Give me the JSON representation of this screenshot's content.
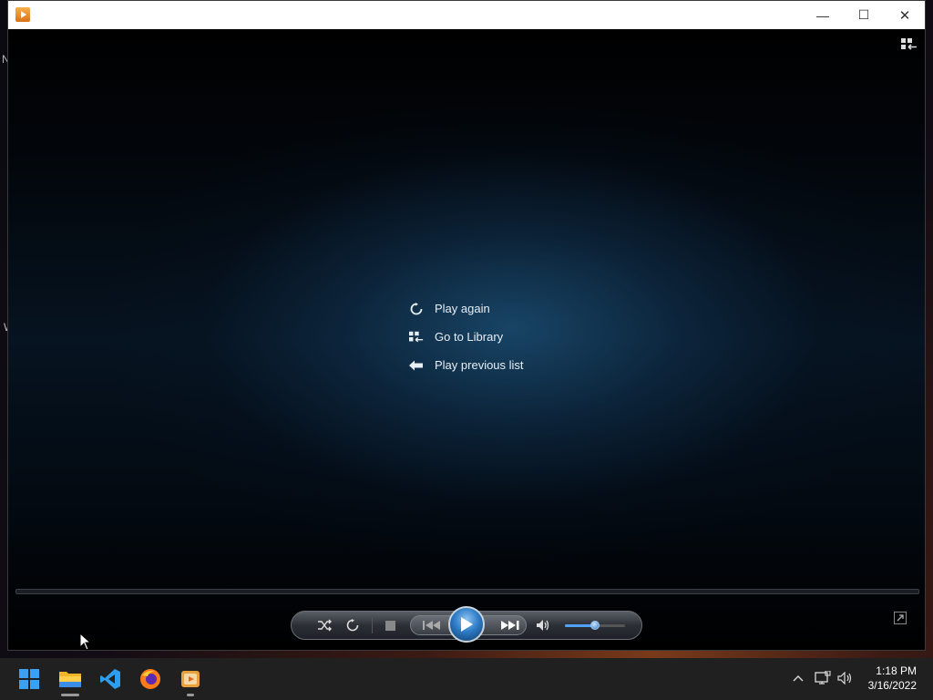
{
  "window": {
    "app_icon": "windows-media-player-icon",
    "controls": {
      "minimize": "—",
      "maximize": "☐",
      "close": "✕"
    }
  },
  "end_menu": {
    "items": [
      {
        "label": "Play again",
        "icon": "replay-icon"
      },
      {
        "label": "Go to Library",
        "icon": "library-icon"
      },
      {
        "label": "Play previous list",
        "icon": "back-arrow-icon"
      }
    ]
  },
  "player": {
    "volume_level": 0.5,
    "buttons": [
      "shuffle",
      "repeat",
      "stop",
      "previous",
      "play",
      "next",
      "mute"
    ]
  },
  "desktop": {
    "left_letters": [
      "N",
      "W"
    ]
  },
  "taskbar": {
    "apps": [
      "start",
      "file-explorer",
      "visual-studio-code",
      "firefox",
      "windows-media-player"
    ],
    "clock": {
      "time": "1:18 PM",
      "date": "3/16/2022"
    }
  },
  "colors": {
    "accent": "#2f7cc7",
    "video_glow": "#1e557d"
  }
}
